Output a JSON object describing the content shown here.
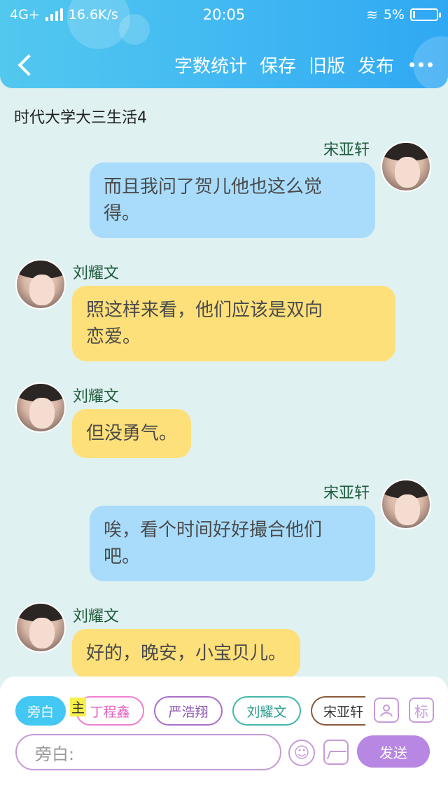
{
  "status_bar": {
    "network": "4G+",
    "speed": "16.6K/s",
    "time": "20:05",
    "battery": "5%"
  },
  "nav": {
    "actions": [
      "字数统计",
      "保存",
      "旧版",
      "发布"
    ]
  },
  "chat_title": "时代大学大三生活4",
  "messages": [
    {
      "sender": "宋亚轩",
      "text_line1": "而且我问了贺儿他也这么觉",
      "text_line2": "得。",
      "side": "right"
    },
    {
      "sender": "刘耀文",
      "text_line1": "照这样来看，他们应该是双向",
      "text_line2": "恋爱。",
      "side": "left"
    },
    {
      "sender": "刘耀文",
      "text_line1": "但没勇气。",
      "side": "left"
    },
    {
      "sender": "宋亚轩",
      "text_line1": "唉，看个时间好好撮合他们",
      "text_line2": "吧。",
      "side": "right"
    },
    {
      "sender": "刘耀文",
      "text_line1": "好的，晚安，小宝贝儿。",
      "side": "left"
    }
  ],
  "roles": [
    "旁白",
    "丁程鑫",
    "严浩翔",
    "刘耀文",
    "宋亚轩"
  ],
  "main_mark": "主",
  "tools": {
    "mark_label": "标"
  },
  "input": {
    "placeholder": "旁白:"
  },
  "send_label": "发送",
  "colors": {
    "header": "#3fb6f2",
    "blue_bubble": "#a9dcfb",
    "yellow_bubble": "#fde07a",
    "send": "#b886e3"
  }
}
